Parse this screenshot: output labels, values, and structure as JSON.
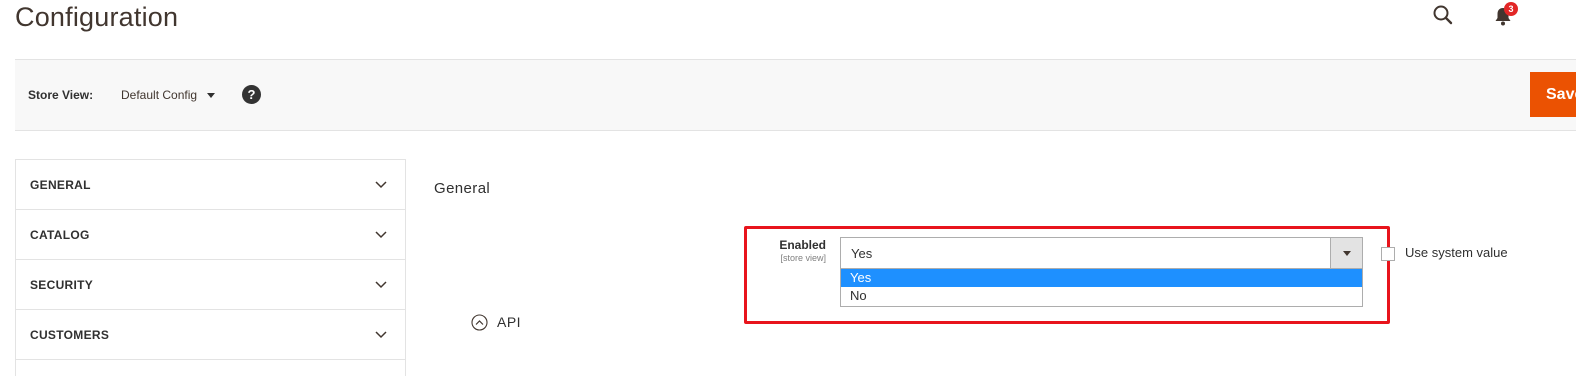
{
  "header": {
    "title": "Configuration",
    "search_icon": "search-icon",
    "notifications_icon": "bell-icon",
    "notifications_count": "3"
  },
  "store_bar": {
    "label": "Store View:",
    "selected": "Default Config",
    "help_icon": "?",
    "save_label": "Save"
  },
  "sidebar": {
    "items": [
      {
        "label": "GENERAL"
      },
      {
        "label": "CATALOG"
      },
      {
        "label": "SECURITY"
      },
      {
        "label": "CUSTOMERS"
      }
    ]
  },
  "main": {
    "section_title": "General",
    "field": {
      "label": "Enabled",
      "scope": "[store view]",
      "value": "Yes",
      "options": [
        "Yes",
        "No"
      ],
      "use_system_value": "Use system value"
    },
    "api_section": "API"
  },
  "colors": {
    "accent_save": "#eb5202",
    "highlight_border": "#e8141c",
    "selected_option": "#1e90ff",
    "badge": "#e22626"
  }
}
